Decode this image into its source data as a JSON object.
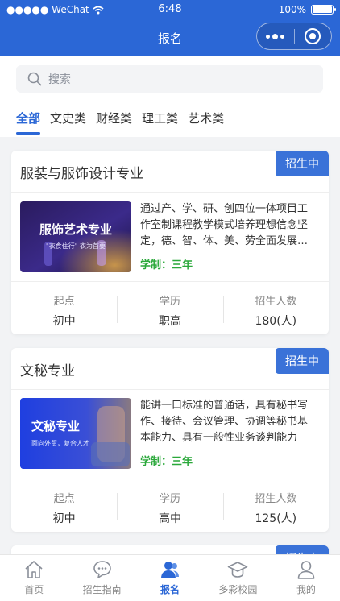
{
  "status_bar": {
    "carrier": "●●●●● WeChat",
    "time": "6:48",
    "battery": "100%",
    "battery_level": 1.0
  },
  "nav": {
    "title": "报名"
  },
  "search": {
    "placeholder": "搜索"
  },
  "tabs": [
    {
      "label": "全部",
      "active": true
    },
    {
      "label": "文史类"
    },
    {
      "label": "财经类"
    },
    {
      "label": "理工类"
    },
    {
      "label": "艺术类"
    }
  ],
  "cards": [
    {
      "title": "服装与服饰设计专业",
      "badge": "招生中",
      "image_title": "服饰艺术专业",
      "image_subtitle": "\"衣食住行\" 衣为首要",
      "description": "通过产、学、研、创四位一体项目工作室制课程教学模式培养理想信念坚定，德、智、体、美、劳全面发展的技术技能人才",
      "years": "学制：三年",
      "stats": [
        {
          "label": "起点",
          "value": "初中"
        },
        {
          "label": "学历",
          "value": "职高"
        },
        {
          "label": "招生人数",
          "value": "180(人)"
        }
      ]
    },
    {
      "title": "文秘专业",
      "badge": "招生中",
      "image_title": "文秘专业",
      "image_subtitle": "面向外贸，复合人才",
      "description": "能讲一口标准的普通话，具有秘书写作、接待、会议管理、协调等秘书基本能力、具有一般性业务谈判能力",
      "years": "学制：三年",
      "stats": [
        {
          "label": "起点",
          "value": "初中"
        },
        {
          "label": "学历",
          "value": "高中"
        },
        {
          "label": "招生人数",
          "value": "125(人)"
        }
      ]
    },
    {
      "badge": "招生中"
    }
  ],
  "bottom_nav": [
    {
      "label": "首页",
      "icon": "home-icon"
    },
    {
      "label": "招生指南",
      "icon": "chat-icon"
    },
    {
      "label": "报名",
      "icon": "user-group-icon",
      "active": true
    },
    {
      "label": "多彩校园",
      "icon": "graduation-cap-icon"
    },
    {
      "label": "我的",
      "icon": "person-icon"
    }
  ],
  "colors": {
    "primary": "#2b67d6",
    "badge": "#3a72d8",
    "years": "#2aa83a",
    "background": "#f2f3f5"
  }
}
